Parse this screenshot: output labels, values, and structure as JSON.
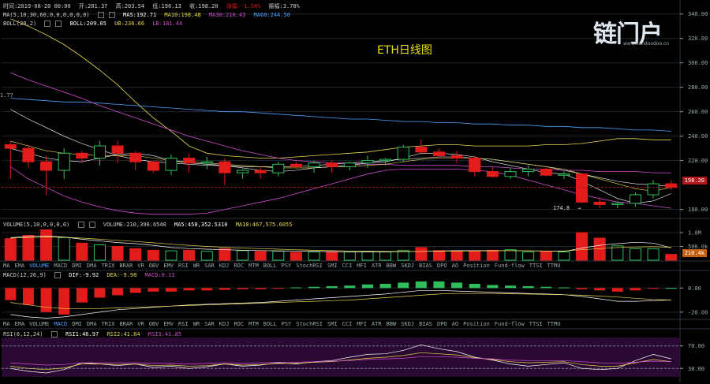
{
  "info": {
    "time": "时间:2019-08-20 00:00",
    "open": "开:201.37",
    "high": "高:203.54",
    "low": "低:196.13",
    "close": "收:198.20",
    "change": "涨幅:-1.58%",
    "amplitude": "振幅:3.78%"
  },
  "ma_line": {
    "label": "MA(5,10,30,60,0,0,0,0,0,0)",
    "ma5": "MA5:192.71",
    "ma10": "MA10:198.48",
    "ma30": "MA30:210.43",
    "ma60": "MA60:244.50"
  },
  "boll_line": {
    "label": "BOLL(20,2)",
    "boll": "BOLL:209.05",
    "ub": "UB:236.66",
    "lb": "LB:181.44"
  },
  "chart_title": "ETH日线图",
  "logo": {
    "text": "链门户",
    "sub": "www.liandoodoo.cn"
  },
  "left_edge_value": "1.77",
  "low_marker": "174.8",
  "last_price": "198.20",
  "last_volume": "210.4k",
  "volume_line": {
    "label": "VOLUME(5,10,0,0,0,0)",
    "volume": "VOLUME:210,390.6540",
    "ma5": "MA5:450,352.5310",
    "ma10": "MA10:467,575.6055"
  },
  "macd_line": {
    "label": "MACD(12,26,9)",
    "dif": "DIF:-9.92",
    "dea": "DEA:-9.98",
    "macd": "MACD:0.11"
  },
  "rsi_line": {
    "label": "RSI(6,12,24)",
    "rsi1": "RSI1:46.97",
    "rsi2": "RSI2:41.84",
    "rsi3": "RSI3:41.85"
  },
  "indicators_1": [
    "MA",
    "EMA",
    "VOLUME",
    "MACD",
    "DMI",
    "DMA",
    "TRIX",
    "BRAR",
    "VR",
    "OBV",
    "EMV",
    "RSI",
    "WR",
    "SAR",
    "KDJ",
    "ROC",
    "MTM",
    "BOLL",
    "PSY",
    "StochRSI",
    "SMI",
    "CCI",
    "MFI",
    "ATR",
    "BBW",
    "SKDJ",
    "BIAS",
    "DPO",
    "AO",
    "Position",
    "Fund-flow",
    "TTSI",
    "TTMU"
  ],
  "indicators_2": [
    "MA",
    "EMA",
    "VOLUME",
    "MACD",
    "DMI",
    "DMA",
    "TRIX",
    "BRAR",
    "VR",
    "OBV",
    "EMV",
    "RSI",
    "WR",
    "SAR",
    "KDJ",
    "ROC",
    "MTM",
    "BOLL",
    "PSY",
    "StochRSI",
    "SMI",
    "CCI",
    "MFI",
    "ATR",
    "BBW",
    "SKDJ",
    "BIAS",
    "DPO",
    "AO",
    "Position",
    "Fund-flow",
    "TTSI",
    "TTMU"
  ],
  "selected_1": "VOLUME",
  "selected_2": "MACD",
  "colors": {
    "up": "#2fbf5a",
    "down": "#e21b1b",
    "ma5": "#ffffff",
    "ma10": "#e6d84a",
    "ma30": "#d24cd2",
    "ma60": "#4aa3ff",
    "bollmid": "#ffffff",
    "bollub": "#e6d84a",
    "bolllb": "#d24cd2",
    "grid": "#1e2630",
    "axis": "#9aa"
  },
  "chart_data": [
    {
      "type": "candlestick",
      "yaxis": [
        "340.00",
        "320.00",
        "300.00",
        "280.00",
        "260.00",
        "240.00",
        "220.00",
        "180.00"
      ],
      "ylim": [
        172,
        345
      ],
      "candles": [
        [
          233,
          236,
          205,
          230
        ],
        [
          230,
          233,
          214,
          219
        ],
        [
          219,
          224,
          192,
          212
        ],
        [
          212,
          230,
          205,
          226
        ],
        [
          226,
          228,
          218,
          222
        ],
        [
          222,
          236,
          216,
          232
        ],
        [
          232,
          236,
          218,
          226
        ],
        [
          226,
          228,
          212,
          219
        ],
        [
          219,
          220,
          210,
          212
        ],
        [
          212,
          225,
          208,
          222
        ],
        [
          222,
          226,
          210,
          218
        ],
        [
          218,
          223,
          213,
          219
        ],
        [
          219,
          222,
          200,
          210
        ],
        [
          210,
          213,
          205,
          212
        ],
        [
          212,
          215,
          205,
          210
        ],
        [
          210,
          219,
          207,
          217
        ],
        [
          217,
          219,
          214,
          215
        ],
        [
          215,
          220,
          210,
          218
        ],
        [
          218,
          220,
          210,
          215
        ],
        [
          215,
          219,
          212,
          218
        ],
        [
          218,
          224,
          214,
          220
        ],
        [
          220,
          222,
          216,
          221
        ],
        [
          221,
          233,
          219,
          231
        ],
        [
          231,
          237,
          225,
          227
        ],
        [
          227,
          230,
          222,
          224
        ],
        [
          224,
          228,
          218,
          222
        ],
        [
          222,
          224,
          207,
          211
        ],
        [
          211,
          215,
          206,
          207
        ],
        [
          207,
          214,
          205,
          211
        ],
        [
          211,
          216,
          207,
          213
        ],
        [
          213,
          214,
          207,
          208
        ],
        [
          208,
          212,
          205,
          209
        ],
        [
          209,
          210,
          185,
          186
        ],
        [
          186,
          190,
          181,
          184
        ],
        [
          184,
          187,
          181,
          185
        ],
        [
          185,
          194,
          182,
          192
        ],
        [
          192,
          204,
          189,
          201
        ],
        [
          201,
          204,
          196,
          198
        ]
      ],
      "ma5": [
        230,
        226,
        222,
        220,
        219,
        222,
        225,
        226,
        224,
        220,
        218,
        217,
        216,
        214,
        212,
        211,
        212,
        214,
        215,
        216,
        218,
        219,
        222,
        226,
        226,
        225,
        223,
        219,
        216,
        213,
        210,
        209,
        203,
        196,
        189,
        185,
        187,
        193
      ],
      "ma10": [
        236,
        232,
        228,
        226,
        225,
        224,
        224,
        224,
        222,
        220,
        219,
        218,
        217,
        216,
        215,
        214,
        214,
        214,
        215,
        215,
        216,
        217,
        219,
        221,
        222,
        222,
        222,
        221,
        219,
        217,
        215,
        213,
        209,
        205,
        201,
        197,
        195,
        198
      ],
      "ma30": [
        292,
        286,
        281,
        276,
        271,
        265,
        260,
        255,
        250,
        245,
        240,
        236,
        232,
        228,
        225,
        222,
        220,
        219,
        218,
        218,
        217,
        217,
        216,
        216,
        216,
        216,
        215,
        215,
        214,
        213,
        213,
        212,
        212,
        211,
        211,
        211,
        210,
        210
      ],
      "ma60": [
        271,
        270,
        269,
        268,
        268,
        267,
        266,
        265,
        264,
        263,
        262,
        261,
        260,
        260,
        259,
        258,
        257,
        256,
        255,
        254,
        254,
        253,
        252,
        252,
        251,
        251,
        250,
        250,
        249,
        249,
        248,
        248,
        247,
        247,
        246,
        245,
        245,
        244
      ],
      "boll_mid": [
        262,
        254,
        247,
        240,
        234,
        229,
        224,
        221,
        219,
        218,
        217,
        216,
        216,
        215,
        215,
        215,
        215,
        216,
        217,
        218,
        219,
        220,
        221,
        222,
        223,
        223,
        222,
        221,
        219,
        217,
        215,
        212,
        209,
        206,
        203,
        201,
        200,
        199
      ],
      "boll_ub": [
        336,
        330,
        323,
        315,
        305,
        294,
        282,
        268,
        255,
        244,
        232,
        226,
        224,
        223,
        222,
        222,
        223,
        224,
        225,
        226,
        227,
        229,
        231,
        232,
        233,
        233,
        232,
        232,
        232,
        232,
        233,
        233,
        234,
        236,
        238,
        238,
        237,
        237
      ],
      "boll_lb": [
        215,
        205,
        198,
        191,
        186,
        182,
        179,
        177,
        176,
        176,
        176,
        177,
        180,
        183,
        186,
        189,
        193,
        197,
        201,
        205,
        209,
        212,
        213,
        213,
        213,
        213,
        212,
        211,
        208,
        204,
        200,
        196,
        192,
        189,
        186,
        185,
        183,
        181
      ]
    },
    {
      "type": "bar",
      "name": "VOLUME",
      "yaxis": [
        "1.0M",
        "500.0k"
      ],
      "ylim": [
        0,
        1200
      ],
      "values": [
        780,
        900,
        1100,
        820,
        620,
        560,
        500,
        420,
        360,
        340,
        360,
        320,
        420,
        350,
        320,
        330,
        280,
        300,
        300,
        300,
        320,
        300,
        350,
        460,
        350,
        340,
        330,
        360,
        380,
        300,
        320,
        300,
        1000,
        800,
        520,
        420,
        410,
        210
      ],
      "ma5": [
        820,
        860,
        880,
        840,
        760,
        700,
        640,
        600,
        540,
        460,
        420,
        400,
        380,
        360,
        350,
        340,
        330,
        320,
        310,
        305,
        300,
        302,
        310,
        320,
        335,
        345,
        345,
        350,
        350,
        340,
        330,
        320,
        440,
        540,
        600,
        650,
        620,
        450
      ],
      "ma10": [
        800,
        820,
        840,
        830,
        800,
        760,
        720,
        680,
        630,
        580,
        540,
        500,
        470,
        440,
        420,
        400,
        380,
        360,
        345,
        335,
        325,
        318,
        318,
        320,
        325,
        330,
        335,
        340,
        345,
        340,
        335,
        330,
        380,
        420,
        460,
        480,
        490,
        468
      ]
    },
    {
      "type": "bar",
      "name": "MACD",
      "yaxis": [
        "0.00",
        "-20.00"
      ],
      "ylim": [
        -26,
        10
      ],
      "values": [
        -10,
        -14,
        -20,
        -22,
        -12,
        -8,
        -6,
        -4,
        -3,
        -3,
        -2,
        -2,
        -1.5,
        -1,
        -1,
        -0.5,
        0.5,
        1,
        1.5,
        2,
        3,
        3.5,
        4.5,
        5.5,
        5.5,
        4.5,
        3.5,
        2.5,
        2,
        1.5,
        1,
        0.5,
        -1,
        -2,
        -3,
        -2,
        -0.5,
        0.11
      ],
      "dif": [
        -22,
        -24,
        -25,
        -24,
        -22,
        -20,
        -18,
        -17,
        -16,
        -15,
        -14,
        -13.5,
        -13,
        -12.5,
        -12,
        -11,
        -10,
        -9,
        -8,
        -7,
        -6,
        -5,
        -3.5,
        -2,
        -2,
        -2.5,
        -3,
        -3.5,
        -4,
        -4.5,
        -5,
        -5.5,
        -7,
        -9,
        -11,
        -11,
        -10.5,
        -9.92
      ],
      "dea": [
        -12,
        -14,
        -16,
        -17,
        -17,
        -17,
        -16.5,
        -16,
        -15.5,
        -15,
        -14.5,
        -14,
        -13.5,
        -13,
        -12.5,
        -12,
        -11.5,
        -11,
        -10.5,
        -10,
        -9,
        -8,
        -7,
        -6,
        -5,
        -4.5,
        -4.5,
        -4.5,
        -4.8,
        -5,
        -5.3,
        -5.6,
        -6,
        -6.7,
        -7.5,
        -8.5,
        -9.5,
        -9.98
      ]
    },
    {
      "type": "line",
      "name": "RSI",
      "yaxis": [
        "70.00",
        "30.00"
      ],
      "ylim": [
        15,
        85
      ],
      "rsi1": [
        30,
        25,
        22,
        28,
        40,
        38,
        35,
        38,
        32,
        34,
        30,
        33,
        38,
        34,
        36,
        40,
        38,
        42,
        44,
        50,
        55,
        56,
        62,
        72,
        65,
        60,
        50,
        45,
        38,
        34,
        37,
        40,
        30,
        28,
        30,
        44,
        55,
        47
      ],
      "rsi2": [
        34,
        30,
        28,
        31,
        38,
        38,
        37,
        38,
        35,
        36,
        34,
        35,
        38,
        36,
        37,
        39,
        39,
        41,
        42,
        45,
        48,
        50,
        53,
        58,
        56,
        54,
        49,
        46,
        42,
        40,
        41,
        42,
        37,
        34,
        34,
        40,
        46,
        42
      ],
      "rsi3": [
        40,
        38,
        36,
        37,
        40,
        40,
        40,
        40,
        39,
        39,
        38,
        39,
        40,
        39,
        40,
        41,
        41,
        42,
        43,
        44,
        46,
        47,
        48,
        51,
        51,
        50,
        48,
        47,
        45,
        44,
        44,
        44,
        42,
        40,
        39,
        41,
        43,
        42
      ]
    }
  ]
}
